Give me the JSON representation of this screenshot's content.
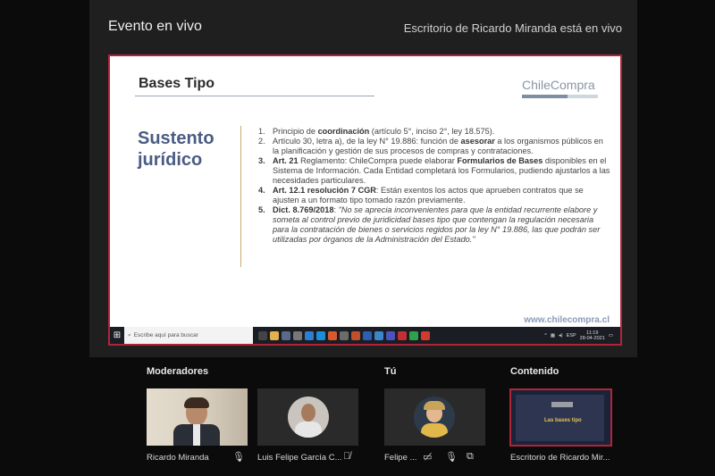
{
  "header": {
    "event_title": "Evento en vivo",
    "live_status": "Escritorio de Ricardo Miranda está en vivo"
  },
  "slide": {
    "title": "Bases Tipo",
    "brand": "ChileCompra",
    "heading_line1": "Sustento",
    "heading_line2": "jurídico",
    "items": [
      {
        "num": "1.",
        "bold_num": false,
        "pre": "Principio de ",
        "bold": "coordinación",
        "post": " (artículo 5°, inciso 2°, ley 18.575)."
      },
      {
        "num": "2.",
        "bold_num": false,
        "pre": "Artículo 30, letra a), de la ley N° 19.886:  función de ",
        "bold": "asesorar",
        "post": " a los organismos públicos en la planificación y gestión de sus procesos de compras y contrataciones."
      },
      {
        "num": "3.",
        "bold_num": true,
        "pre": "",
        "bold": "Art. 21",
        "post": " Reglamento: ChileCompra puede elaborar  ",
        "bold2": "Formularios de Bases",
        "post2": " disponibles en el Sistema de Información. Cada Entidad completará los Formularios, pudiendo ajustarlos a las necesidades particulares."
      },
      {
        "num": "4.",
        "bold_num": true,
        "pre": "",
        "bold": "Art. 12.1 resolución 7 CGR",
        "post": ": Están exentos los actos que aprueben contratos que se ajusten a un formato tipo tomado razón previamente."
      },
      {
        "num": "5.",
        "bold_num": true,
        "pre": "",
        "bold": "Dict. 8.769/2018",
        "post": ": ",
        "italic": "\"No se aprecia inconvenientes para que la entidad recurrente elabore y someta al control previo de juridicidad bases tipo que contengan la regulación necesaria para la contratación de bienes o servicios regidos por la ley N° 19.886, las que podrán ser utilizadas por órganos de la Administración del Estado.\""
      }
    ],
    "site": "www.chilecompra.cl"
  },
  "taskbar": {
    "search_placeholder": "Escribe aquí para buscar",
    "lang": "ESP",
    "time": "11:19",
    "date": "28-04-2021"
  },
  "sections": {
    "moderators": "Moderadores",
    "you": "Tú",
    "content": "Contenido"
  },
  "participants": [
    {
      "name": "Ricardo Miranda"
    },
    {
      "name": "Luis Felipe García C..."
    },
    {
      "name": "Felipe ..."
    },
    {
      "name": "Escritorio de Ricardo Mir..."
    }
  ],
  "thumbnail": {
    "title": "Las bases tipo"
  },
  "colors": {
    "accent": "#b0243a",
    "heading": "#4a5c84"
  }
}
